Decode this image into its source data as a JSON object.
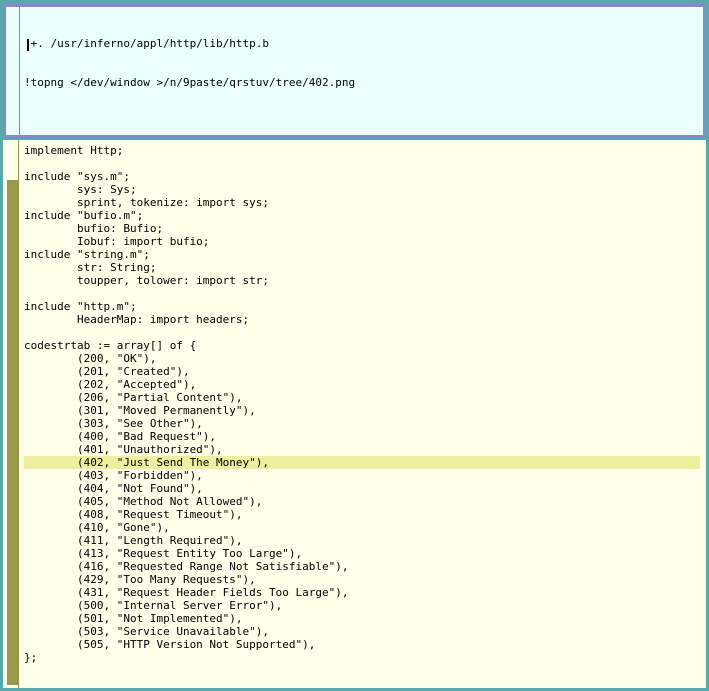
{
  "tag": {
    "lines": [
      " +. /usr/inferno/appl/http/lib/http.b",
      "!topng </dev/window >/n/9paste/qrstuv/tree/402.png"
    ]
  },
  "code": {
    "lines": [
      "implement Http;",
      "",
      "include \"sys.m\";",
      "        sys: Sys;",
      "        sprint, tokenize: import sys;",
      "include \"bufio.m\";",
      "        bufio: Bufio;",
      "        Iobuf: import bufio;",
      "include \"string.m\";",
      "        str: String;",
      "        toupper, tolower: import str;",
      "",
      "include \"http.m\";",
      "        HeaderMap: import headers;",
      "",
      "codestrtab := array[] of {",
      "        (200, \"OK\"),",
      "        (201, \"Created\"),",
      "        (202, \"Accepted\"),",
      "        (206, \"Partial Content\"),",
      "        (301, \"Moved Permanently\"),",
      "        (303, \"See Other\"),",
      "        (400, \"Bad Request\"),",
      "        (401, \"Unauthorized\"),",
      "        (402, \"Just Send The Money\"),",
      "        (403, \"Forbidden\"),",
      "        (404, \"Not Found\"),",
      "        (405, \"Method Not Allowed\"),",
      "        (408, \"Request Timeout\"),",
      "        (410, \"Gone\"),",
      "        (411, \"Length Required\"),",
      "        (413, \"Request Entity Too Large\"),",
      "        (416, \"Requested Range Not Satisfiable\"),",
      "        (429, \"Too Many Requests\"),",
      "        (431, \"Request Header Fields Too Large\"),",
      "        (500, \"Internal Server Error\"),",
      "        (501, \"Not Implemented\"),",
      "        (503, \"Service Unavailable\"),",
      "        (505, \"HTTP Version Not Supported\"),",
      "};"
    ],
    "highlighted_line": 24
  },
  "colors": {
    "desktop": "#55aaaa",
    "tag_bg": "#eaffff",
    "tag_border": "#8888cc",
    "body_bg": "#ffffea",
    "scrollbar": "#99994c",
    "highlight": "#eeee9e"
  }
}
